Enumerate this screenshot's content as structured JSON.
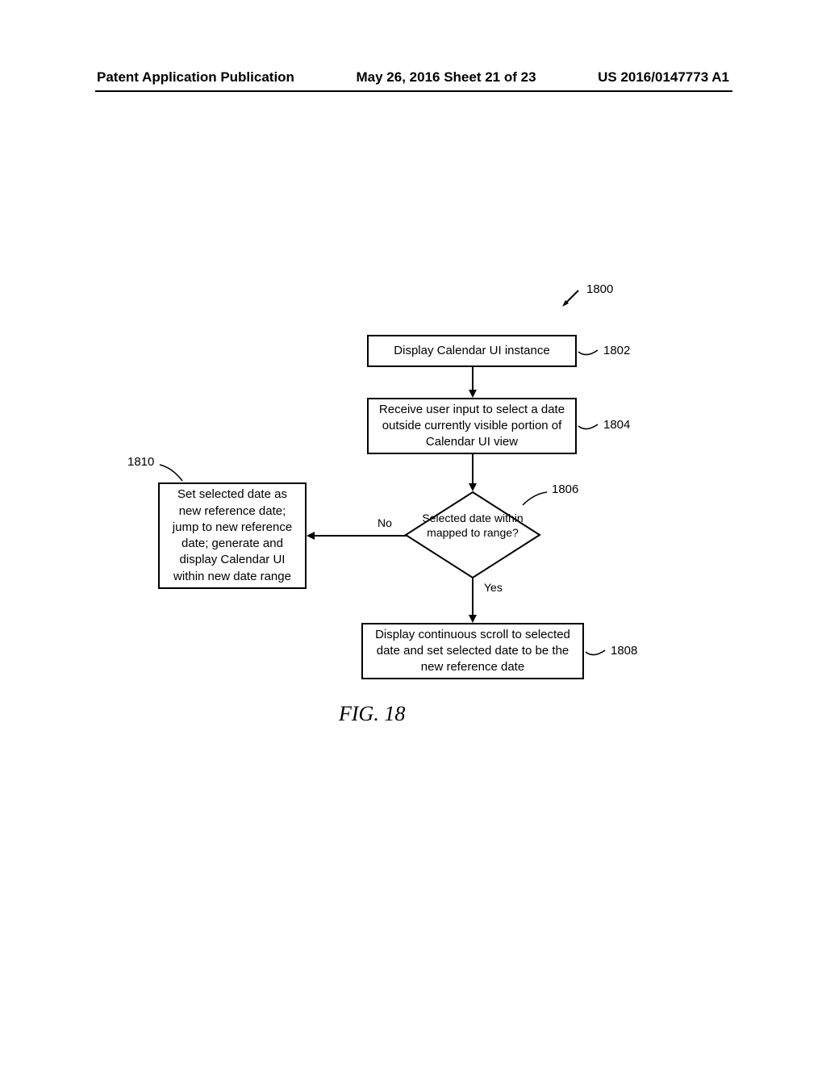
{
  "header": {
    "left": "Patent Application Publication",
    "center": "May 26, 2016  Sheet 21 of 23",
    "right": "US 2016/0147773 A1"
  },
  "flow": {
    "ref_1800": "1800",
    "box_1802": "Display Calendar UI instance",
    "ref_1802": "1802",
    "box_1804": "Receive user input to select a date outside currently visible portion of Calendar UI view",
    "ref_1804": "1804",
    "decision_1806": "Selected date within mapped to range?",
    "ref_1806": "1806",
    "label_no": "No",
    "label_yes": "Yes",
    "box_1808": "Display continuous scroll to selected date and set selected date to be the new reference date",
    "ref_1808": "1808",
    "box_1810": "Set selected date as new reference date; jump to new reference date; generate and display Calendar UI within new date range",
    "ref_1810": "1810"
  },
  "figure_label": "FIG. 18"
}
